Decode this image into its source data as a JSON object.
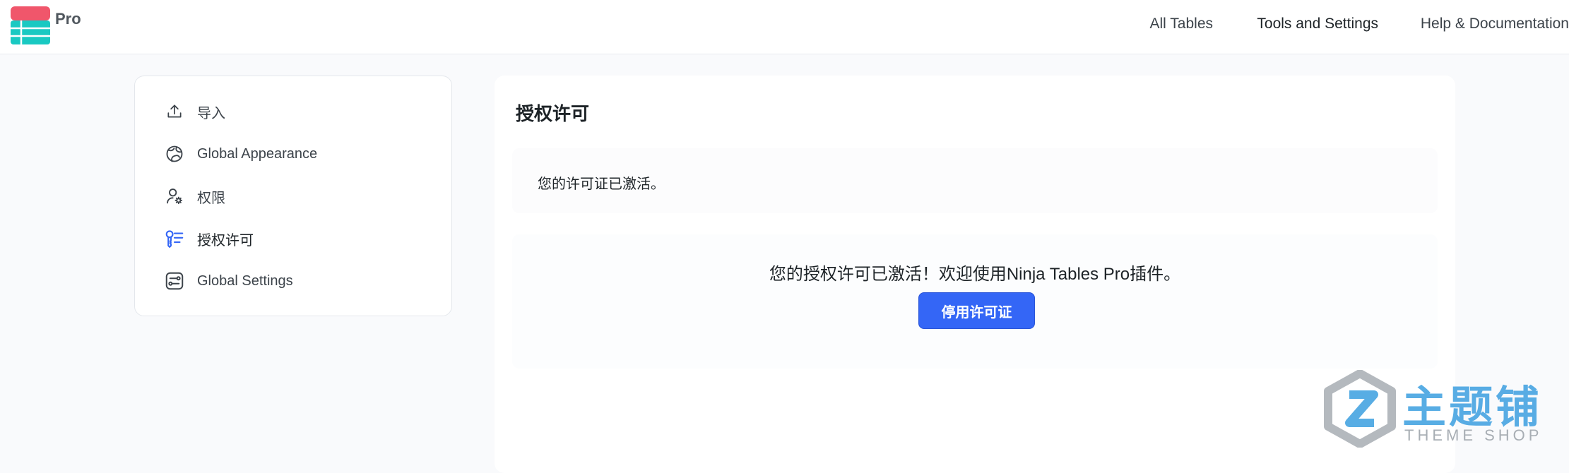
{
  "brand": {
    "product_label": "Pro",
    "colors": {
      "logo_top": "#f0566b",
      "logo_bottom": "#19c9c2",
      "primary": "#3466f6"
    }
  },
  "topnav": [
    {
      "label": "All Tables",
      "active": false
    },
    {
      "label": "Tools and Settings",
      "active": true
    },
    {
      "label": "Help & Documentation",
      "active": false
    }
  ],
  "sidebar": {
    "items": [
      {
        "label": "导入",
        "icon": "upload-icon",
        "active": false
      },
      {
        "label": "Global Appearance",
        "icon": "palette-icon",
        "active": false
      },
      {
        "label": "权限",
        "icon": "user-settings-icon",
        "active": false
      },
      {
        "label": "授权许可",
        "icon": "license-key-icon",
        "active": true
      },
      {
        "label": "Global Settings",
        "icon": "settings-sliders-icon",
        "active": false
      }
    ]
  },
  "main": {
    "title": "授权许可",
    "notice": "您的许可证已激活。",
    "license_message": "您的授权许可已激活！欢迎使用Ninja Tables Pro插件。",
    "deactivate_label": "停用许可证"
  },
  "watermark": {
    "cn": "主题铺",
    "en": "THEME SHOP"
  }
}
